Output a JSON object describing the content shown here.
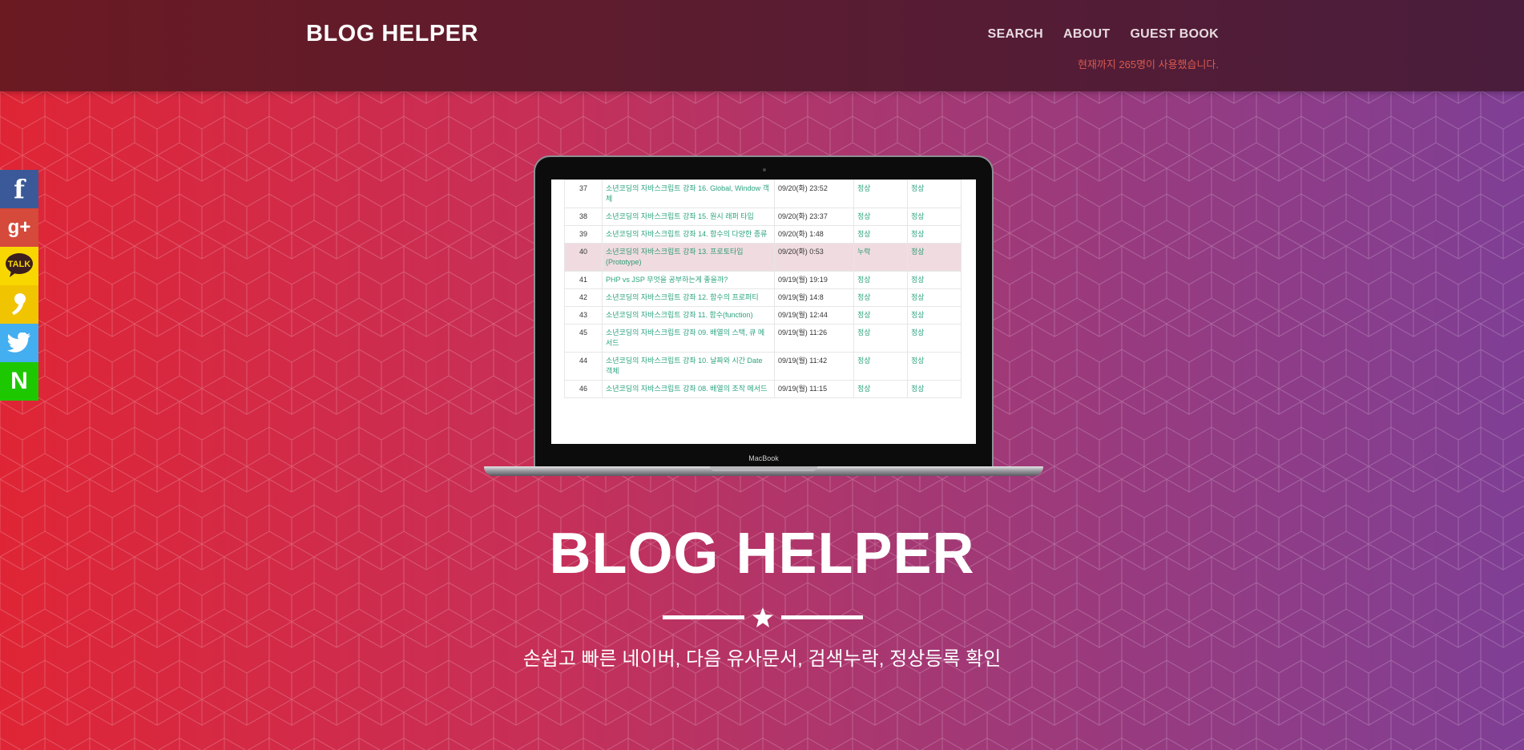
{
  "header": {
    "brand": "BLOG HELPER",
    "nav": [
      "SEARCH",
      "ABOUT",
      "GUEST BOOK"
    ],
    "visitor_counter": "현재까지 265명이 사용했습니다."
  },
  "social": [
    {
      "name": "facebook",
      "label": "f"
    },
    {
      "name": "google-plus",
      "label": "g+"
    },
    {
      "name": "kakaotalk",
      "label": "TALK"
    },
    {
      "name": "kakaostory",
      "label": ""
    },
    {
      "name": "twitter",
      "label": ""
    },
    {
      "name": "naver",
      "label": "N"
    }
  ],
  "laptop": {
    "label": "MacBook",
    "rows": [
      {
        "num": "37",
        "title": "소년코딩의 자바스크립트 강좌 16. Global, Window 객체",
        "date": "09/20(화) 23:52",
        "s1": "정상",
        "s2": "정상"
      },
      {
        "num": "38",
        "title": "소년코딩의 자바스크립트 강좌 15. 원시 래퍼 타입",
        "date": "09/20(화) 23:37",
        "s1": "정상",
        "s2": "정상"
      },
      {
        "num": "39",
        "title": "소년코딩의 자바스크립트 강좌 14. 함수의 다양한 종류",
        "date": "09/20(화) 1:48",
        "s1": "정상",
        "s2": "정상"
      },
      {
        "num": "40",
        "title": "소년코딩의 자바스크립트 강좌 13. 프로토타입 (Prototype)",
        "date": "09/20(화) 0:53",
        "s1": "누락",
        "s2": "정상",
        "highlight": true
      },
      {
        "num": "41",
        "title": "PHP vs JSP 무엇을 공부하는게 좋을까?",
        "date": "09/19(월) 19:19",
        "s1": "정상",
        "s2": "정상"
      },
      {
        "num": "42",
        "title": "소년코딩의 자바스크립트 강좌 12. 함수의 프로퍼티",
        "date": "09/19(월) 14:8",
        "s1": "정상",
        "s2": "정상"
      },
      {
        "num": "43",
        "title": "소년코딩의 자바스크립트 강좌 11. 함수(function)",
        "date": "09/19(월) 12:44",
        "s1": "정상",
        "s2": "정상"
      },
      {
        "num": "45",
        "title": "소년코딩의 자바스크립트 강좌 09. 배열의 스택, 큐 메서드",
        "date": "09/19(월) 11:26",
        "s1": "정상",
        "s2": "정상"
      },
      {
        "num": "44",
        "title": "소년코딩의 자바스크립트 강좌 10. 날짜와 시간 Date 객체",
        "date": "09/19(월) 11:42",
        "s1": "정상",
        "s2": "정상"
      },
      {
        "num": "46",
        "title": "소년코딩의 자바스크립트 강좌 08. 배열의 조작 메서드",
        "date": "09/19(월) 11:15",
        "s1": "정상",
        "s2": "정상"
      }
    ]
  },
  "hero": {
    "title": "BLOG HELPER",
    "tagline": "손쉽고 빠른 네이버, 다음 유사문서, 검색누락, 정상등록 확인"
  },
  "colors": {
    "gradient_left": "#df2535",
    "gradient_right": "#7f3f95",
    "header_bg": "#5c1c30",
    "link_green": "#2aa37d"
  }
}
